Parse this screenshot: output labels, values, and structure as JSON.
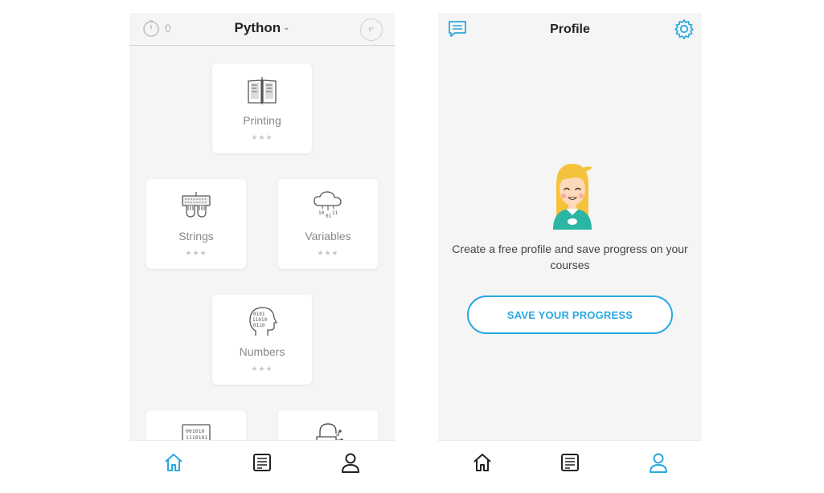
{
  "colors": {
    "accent": "#29a8e0",
    "background": "#f5f5f5",
    "icon_gray": "#333333"
  },
  "left_screen": {
    "header": {
      "streak_icon": "stopwatch-icon",
      "streak_count": "0",
      "course_title": "Python",
      "dropdown_icon": "chevron-down-icon",
      "timer_icon": "timer-icon"
    },
    "lessons": [
      {
        "label": "Printing",
        "icon": "book-icon",
        "stars": "★★★"
      },
      {
        "label": "Strings",
        "icon": "keyboard-icon",
        "stars": "★★★"
      },
      {
        "label": "Variables",
        "icon": "cloud-data-icon",
        "stars": "★★★"
      },
      {
        "label": "Numbers",
        "icon": "binary-head-icon",
        "stars": "★★★"
      },
      {
        "label": "",
        "icon": "binary-screen-icon",
        "stars": ""
      },
      {
        "label": "",
        "icon": "lock-circuit-icon",
        "stars": ""
      }
    ],
    "nav": [
      {
        "name": "home",
        "icon": "home-icon",
        "active": true
      },
      {
        "name": "articles",
        "icon": "document-icon",
        "active": false
      },
      {
        "name": "profile",
        "icon": "user-icon",
        "active": false
      }
    ]
  },
  "right_screen": {
    "header": {
      "title": "Profile",
      "chat_icon": "chat-icon",
      "settings_icon": "gear-icon"
    },
    "avatar_icon": "girl-avatar-icon",
    "message": "Create a free profile and save progress on your courses",
    "save_button": "SAVE YOUR PROGRESS",
    "nav": [
      {
        "name": "home",
        "icon": "home-icon",
        "active": false
      },
      {
        "name": "articles",
        "icon": "document-icon",
        "active": false
      },
      {
        "name": "profile",
        "icon": "user-icon",
        "active": true
      }
    ]
  }
}
